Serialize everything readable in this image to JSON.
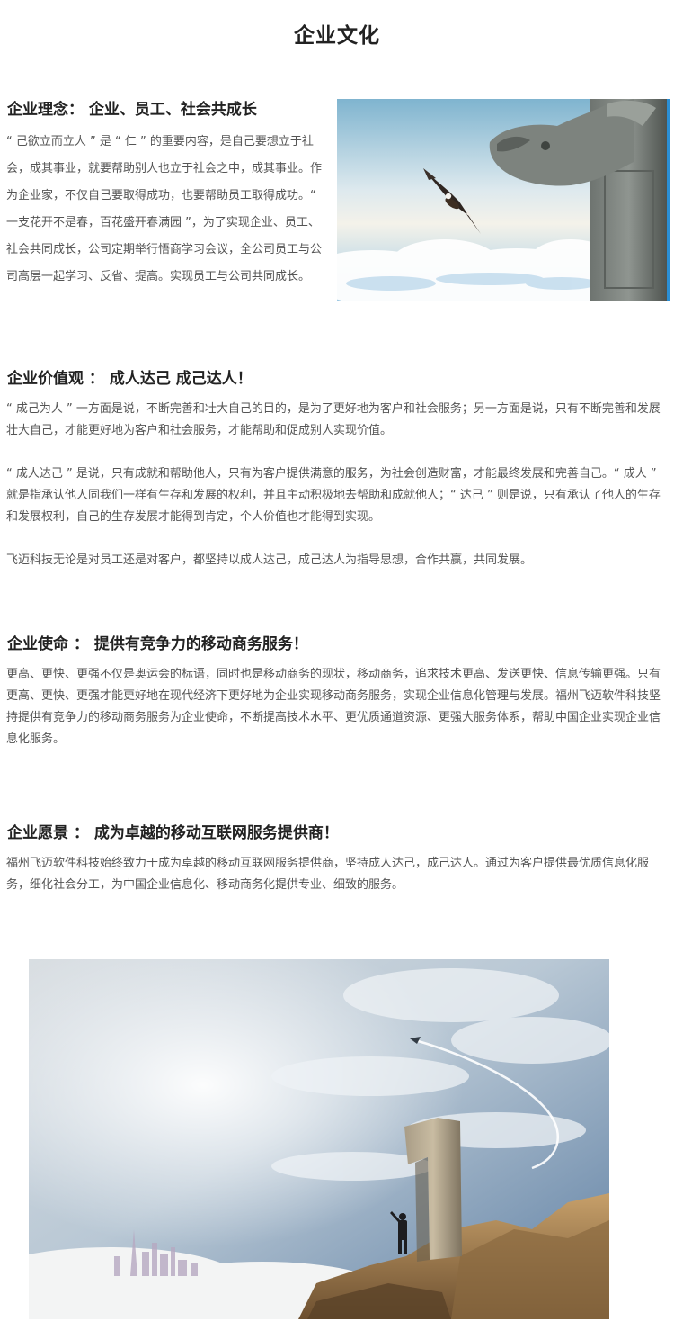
{
  "page": {
    "title": "企业文化"
  },
  "sections": {
    "philosophy": {
      "heading": "企业理念： 企业、员工、社会共成长",
      "body": "“ 己欲立而立人 ” 是 “ 仁 ” 的重要内容，是自己要想立于社会，成其事业，就要帮助别人也立于社会之中，成其事业。作为企业家，不仅自己要取得成功，也要帮助员工取得成功。“ 一支花开不是春，百花盛开春满园 ”，为了实现企业、员工、社会共同成长，公司定期举行悟商学习会议，全公司员工与公司高层一起学习、反省、提高。实现员工与公司共同成长。"
    },
    "values": {
      "heading": "企业价值观 ： 成人达己 成己达人！",
      "p1": "“ 成己为人 ” 一方面是说，不断完善和壮大自己的目的，是为了更好地为客户和社会服务；另一方面是说，只有不断完善和发展壮大自己，才能更好地为客户和社会服务，才能帮助和促成别人实现价值。",
      "p2": "“ 成人达己 ” 是说，只有成就和帮助他人，只有为客户提供满意的服务，为社会创造财富，才能最终发展和完善自己。“ 成人 ” 就是指承认他人同我们一样有生存和发展的权利，并且主动积极地去帮助和成就他人；“ 达己 ” 则是说，只有承认了他人的生存和发展权利，自己的生存发展才能得到肯定，个人价值也才能得到实现。",
      "p3": "飞迈科技无论是对员工还是对客户，都坚持以成人达己，成己达人为指导思想，合作共赢，共同发展。"
    },
    "mission": {
      "heading": "企业使命 ： 提供有竞争力的移动商务服务！",
      "body": "更高、更快、更强不仅是奥运会的标语，同时也是移动商务的现状，移动商务，追求技术更高、发送更快、信息传输更强。只有更高、更快、更强才能更好地在现代经济下更好地为企业实现移动商务服务，实现企业信息化管理与发展。福州飞迈软件科技坚持提供有竞争力的移动商务服务为企业使命，不断提高技术水平、更优质通道资源、更强大服务体系，帮助中国企业实现企业信息化服务。"
    },
    "vision": {
      "heading": "企业愿景 ： 成为卓越的移动互联网服务提供商！",
      "body": "福州飞迈软件科技始终致力于成为卓越的移动互联网服务提供商，坚持成人达己，成己达人。通过为客户提供最优质信息化服务，细化社会分工，为中国企业信息化、移动商务化提供专业、细致的服务。"
    }
  },
  "images": {
    "top": {
      "icon": "eagle-dragon-statue-photo"
    },
    "bottom": {
      "icon": "number-one-cliff-sky-photo"
    }
  },
  "colors": {
    "accent": "#2a8fd6",
    "heading": "#222222",
    "text": "#555555"
  }
}
